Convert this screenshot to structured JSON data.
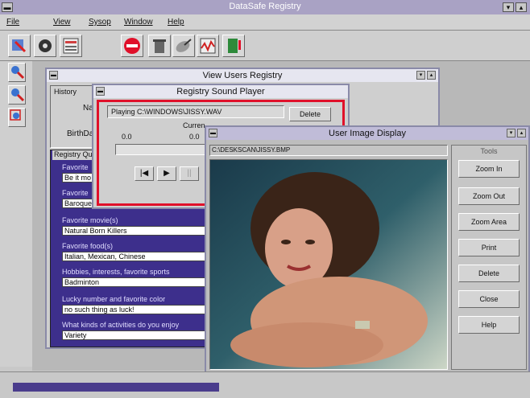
{
  "app": {
    "title": "DataSafe Registry"
  },
  "menu": [
    "File",
    "View",
    "Sysop",
    "Window",
    "Help"
  ],
  "users_window": {
    "title": "View Users Registry",
    "history_label": "History",
    "name_label": "Name",
    "birthdate_label": "BirthDa",
    "registry_group": "Registry Qu",
    "fields": [
      {
        "label": "Favorite",
        "value": "Be it mo"
      },
      {
        "label": "Favorite",
        "value": "Baroque"
      },
      {
        "label": "Favorite movie(s)",
        "value": "Natural Born Killers"
      },
      {
        "label": "Favorite food(s)",
        "value": "Italian, Mexican, Chinese"
      },
      {
        "label": "Hobbies, interests, favorite sports",
        "value": "Badminton"
      },
      {
        "label": "Lucky number and favorite color",
        "value": "no such thing as luck!"
      },
      {
        "label": "What kinds of activities do you enjoy",
        "value": "Variety"
      }
    ]
  },
  "sound_window": {
    "title": "Registry Sound Player",
    "playing": "Playing C:\\WINDOWS\\JISSY.WAV",
    "delete": "Delete",
    "current_label": "Curren",
    "time_left": "0.0",
    "time_right": "0.0"
  },
  "image_window": {
    "title": "User Image Display",
    "path": "C:\\DESKSCAN\\JISSY.BMP",
    "tools_title": "Tools",
    "tools": [
      {
        "label": "Zoom In",
        "hot": "I"
      },
      {
        "label": "Zoom Out",
        "hot": "O"
      },
      {
        "label": "Zoom Area",
        "hot": "A"
      },
      {
        "label": "Print",
        "hot": "P"
      },
      {
        "label": "Delete",
        "hot": "D"
      },
      {
        "label": "Close",
        "hot": "C"
      },
      {
        "label": "Help",
        "hot": "H"
      }
    ]
  },
  "colors": {
    "accent": "#3d2f8c",
    "highlight": "#e0102a",
    "window_title": "#a9a2c4"
  }
}
